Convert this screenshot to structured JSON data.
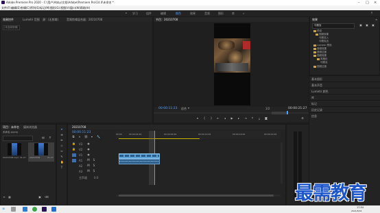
{
  "window": {
    "title": "Adobe Premiere Pro 2020 - C:\\用户\\Abby\\文档\\Adobe\\Premiere Pro\\14.0\\未命名 *"
  },
  "menu": [
    "文件(F)",
    "编辑(E)",
    "剪辑(C)",
    "序列(S)",
    "标记(M)",
    "图形(G)",
    "视图(V)",
    "窗口(W)",
    "帮助(H)"
  ],
  "workspaces": {
    "items": [
      "学习",
      "组件",
      "编辑",
      "颜色",
      "效果",
      "音频",
      "图形",
      "库"
    ],
    "active_index": 3
  },
  "left_panel": {
    "tabs": [
      "效果控件",
      "Lumetri 范围",
      "源：(无剪辑)",
      "音频剪辑混合器：20210708"
    ],
    "active_tab_index": 0,
    "message": "(未选择剪辑)"
  },
  "program": {
    "tab_label": "节目：20210708",
    "timecode": "00:00:11:23",
    "fit": "适合",
    "quality": "1/2",
    "duration": "00:00:21:27"
  },
  "project": {
    "tabs": [
      "项目：未命名",
      "媒体浏览器"
    ],
    "file_name": "未命名.prproj",
    "items": [
      {
        "name": "20210708.mp4",
        "duration": "21:27"
      },
      {
        "name": "20210708",
        "duration": "21:27"
      }
    ]
  },
  "timeline": {
    "tab_label": "20210708",
    "timecode": "00:00:11:23",
    "ruler_ticks": [
      "00:00",
      "00:00:04:29",
      "00:00:09:29",
      "00:00:14:29",
      "00:00:19:29",
      "00:00:24:29"
    ],
    "video_tracks": [
      "V3",
      "V2",
      "V1"
    ],
    "audio_tracks": [
      "A1",
      "A2",
      "A3"
    ],
    "master_label": "主声道",
    "master_value": "0.0"
  },
  "effects": {
    "title": "效果",
    "search_value": "马赛克",
    "tree": [
      "预设",
      "视频效果",
      "马赛克入",
      "马赛克出",
      "Lumetri 预设",
      "音频效果",
      "音频过渡",
      "视频效果",
      "风格化",
      "马赛克",
      "视频过渡"
    ],
    "sections": [
      "基本图形",
      "基本声音",
      "Lumetri 颜色",
      "库",
      "标记",
      "历史记录",
      "信息"
    ]
  },
  "taskbar": {
    "time": "17:54",
    "date": "2021/8/24"
  },
  "watermark": "最需教育",
  "colors": {
    "accent": "#4ea0ff",
    "clip": "#5aa2d6",
    "playhead": "#4ea0ff",
    "work_area": "#c8b400"
  }
}
